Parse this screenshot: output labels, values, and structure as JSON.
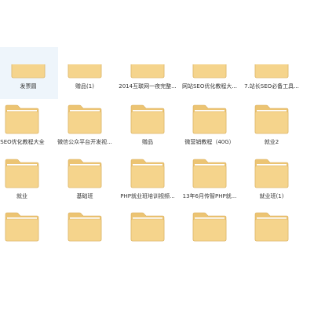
{
  "folder_colors": {
    "body": "#f5d48c",
    "tab": "#ecc473",
    "edge": "#d9b061",
    "paper": "#ffffff"
  },
  "icon": "folder-icon",
  "rows": [
    {
      "row": "1",
      "items": [
        {
          "label": "发票圆"
        },
        {
          "label": "赠品(1)"
        },
        {
          "label": "2014互联网一夜完整..."
        },
        {
          "label": "网站SEO优化教程大..."
        },
        {
          "label": "7.站长SEO必备工具..."
        }
      ]
    },
    {
      "row": "2",
      "items": [
        {
          "label": "站SEO优化教程大全"
        },
        {
          "label": "微信公众平台开发视..."
        },
        {
          "label": "赠品"
        },
        {
          "label": "微营销教程（40G）"
        },
        {
          "label": "就业2"
        }
      ]
    },
    {
      "row": "3",
      "items": [
        {
          "label": "就业"
        },
        {
          "label": "基础班"
        },
        {
          "label": "PHP就业班培训视频..."
        },
        {
          "label": "13年6月传智PHP就..."
        },
        {
          "label": "就业班(1)"
        }
      ]
    },
    {
      "row": "4",
      "items": [
        {
          "label": ""
        },
        {
          "label": ""
        },
        {
          "label": ""
        },
        {
          "label": ""
        },
        {
          "label": ""
        }
      ]
    }
  ]
}
